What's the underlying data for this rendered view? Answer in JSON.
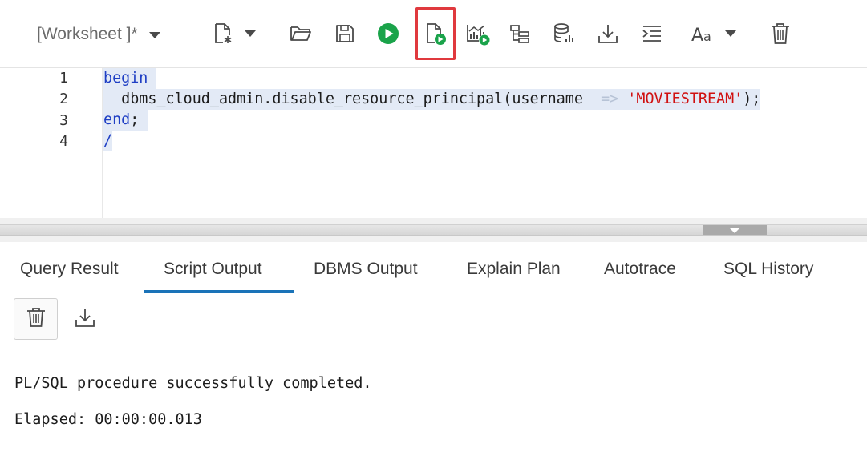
{
  "toolbar": {
    "worksheet_tab": "[Worksheet ]*",
    "buttons": [
      {
        "icon": "new-worksheet-icon"
      },
      {
        "icon": "open-folder-icon"
      },
      {
        "icon": "save-icon"
      },
      {
        "icon": "run-statement-icon",
        "color": "#1aa34a"
      },
      {
        "icon": "run-script-icon",
        "color": "#1aa34a",
        "highlighted": true
      },
      {
        "icon": "autotrace-icon"
      },
      {
        "icon": "explain-plan-icon"
      },
      {
        "icon": "sql-tuning-advisor-icon"
      },
      {
        "icon": "download-icon"
      },
      {
        "icon": "format-icon"
      },
      {
        "icon": "font-size-icon"
      },
      {
        "icon": "clear-icon"
      }
    ],
    "highlight_color": "#e0393e"
  },
  "editor": {
    "line_numbers": [
      "1",
      "2",
      "3",
      "4"
    ],
    "lines": {
      "l1_kw": "begin",
      "l2_indent": "  ",
      "l2_call": "dbms_cloud_admin.disable_resource_principal(username",
      "l2_gap": "  ",
      "l2_arrow": "=>",
      "l2_sp": " ",
      "l2_str": "'MOVIESTREAM'",
      "l2_end": ");",
      "l3_kw": "end",
      "l3_end": ";",
      "l4": "/"
    },
    "colors": {
      "keyword": "#1f3fc4",
      "string": "#d01010",
      "selection": "#e3eaf6"
    }
  },
  "tabs": [
    {
      "label": "Query Result"
    },
    {
      "label": "Script Output",
      "active": true
    },
    {
      "label": "DBMS Output"
    },
    {
      "label": "Explain Plan"
    },
    {
      "label": "Autotrace"
    },
    {
      "label": "SQL History"
    }
  ],
  "output_toolbar": {
    "buttons": [
      {
        "icon": "trash-icon"
      },
      {
        "icon": "download-icon"
      }
    ]
  },
  "output": {
    "line1": "PL/SQL procedure successfully completed.",
    "line2": "Elapsed: 00:00:00.013"
  },
  "accent_color": "#1a73b8"
}
